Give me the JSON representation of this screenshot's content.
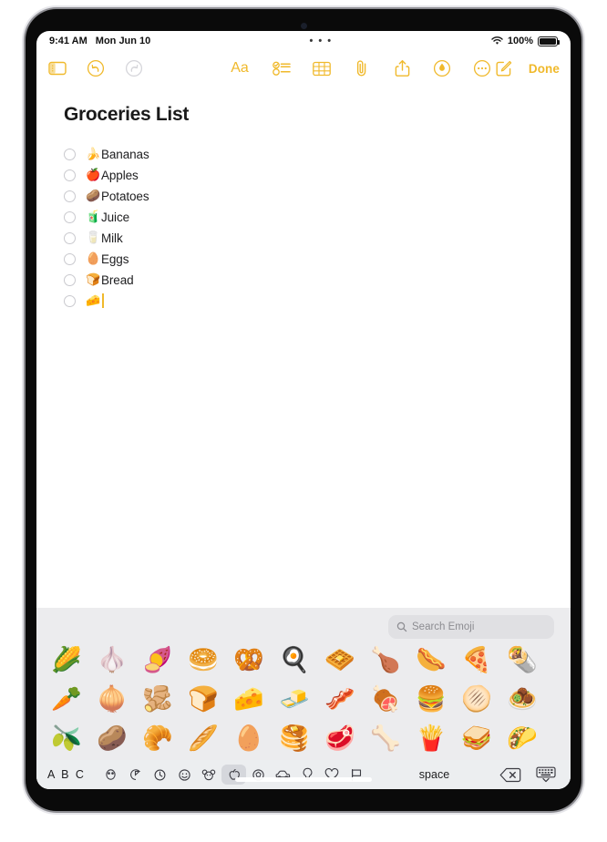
{
  "status_bar": {
    "time": "9:41 AM",
    "date": "Mon Jun 10",
    "center_dots": "• • •",
    "battery_percent": "100%",
    "wifi_icon": "wifi-icon",
    "battery_icon": "battery-icon"
  },
  "toolbar": {
    "sidebar_icon": "sidebar-toggle-icon",
    "undo_icon": "undo-icon",
    "redo_icon": "redo-icon",
    "format_label": "Aa",
    "checklist_icon": "checklist-icon",
    "table_icon": "table-icon",
    "attachment_icon": "paperclip-icon",
    "share_icon": "share-icon",
    "markup_icon": "markup-pen-icon",
    "more_icon": "more-ellipsis-icon",
    "compose_icon": "compose-icon",
    "done_label": "Done"
  },
  "note": {
    "title": "Groceries List",
    "checklist": [
      {
        "emoji": "🍌",
        "emoji_name": "banana-emoji",
        "label": "Bananas",
        "checked": false
      },
      {
        "emoji": "🍎",
        "emoji_name": "red-apple-emoji",
        "label": "Apples",
        "checked": false
      },
      {
        "emoji": "🥔",
        "emoji_name": "potato-emoji",
        "label": "Potatoes",
        "checked": false
      },
      {
        "emoji": "🧃",
        "emoji_name": "beverage-box-emoji",
        "label": "Juice",
        "checked": false
      },
      {
        "emoji": "🥛",
        "emoji_name": "glass-of-milk-emoji",
        "label": "Milk",
        "checked": false
      },
      {
        "emoji": "🥚",
        "emoji_name": "egg-emoji",
        "label": "Eggs",
        "checked": false
      },
      {
        "emoji": "🍞",
        "emoji_name": "bread-emoji",
        "label": "Bread",
        "checked": false
      },
      {
        "emoji": "🧀",
        "emoji_name": "cheese-wedge-emoji",
        "label": "",
        "checked": false,
        "cursor": true
      }
    ]
  },
  "keyboard": {
    "search": {
      "placeholder": "Search Emoji",
      "value": "",
      "icon": "search-icon"
    },
    "emoji_rows": [
      [
        "🌽",
        "🧄",
        "🍠",
        "🥯",
        "🥨",
        "🍳",
        "🧇",
        "🍗",
        "🌭",
        "🍕",
        "🌯"
      ],
      [
        "🥕",
        "🧅",
        "🫚",
        "🍞",
        "🧀",
        "🧈",
        "🥓",
        "🍖",
        "🍔",
        "🫓",
        "🧆"
      ],
      [
        "🫒",
        "🥔",
        "🥐",
        "🥖",
        "🥚",
        "🥞",
        "🥩",
        "🦴",
        "🍟",
        "🥪",
        "🌮"
      ]
    ],
    "abc_label": "A B C",
    "categories": [
      {
        "name": "category-frequently-used",
        "icon": "clock-face-icon",
        "selected": false
      },
      {
        "name": "category-recents",
        "icon": "partial-circle-icon",
        "selected": false
      },
      {
        "name": "category-clock",
        "icon": "clock-icon",
        "selected": false
      },
      {
        "name": "category-smileys",
        "icon": "smiley-icon",
        "selected": false
      },
      {
        "name": "category-animals",
        "icon": "animal-paw-icon",
        "selected": false
      },
      {
        "name": "category-food",
        "icon": "apple-icon",
        "selected": true
      },
      {
        "name": "category-activities",
        "icon": "ball-icon",
        "selected": false
      },
      {
        "name": "category-travel",
        "icon": "car-icon",
        "selected": false
      },
      {
        "name": "category-objects",
        "icon": "lightbulb-icon",
        "selected": false
      },
      {
        "name": "category-symbols",
        "icon": "heart-icon",
        "selected": false
      },
      {
        "name": "category-flags",
        "icon": "flag-icon",
        "selected": false
      }
    ],
    "space_label": "space",
    "delete_icon": "delete-backspace-icon",
    "dismiss_icon": "keyboard-dismiss-icon"
  },
  "colors": {
    "accent": "#f0b92b",
    "disabled": "#d5d5da",
    "keyboard_bg": "#ececee",
    "text": "#1d1d1f"
  }
}
